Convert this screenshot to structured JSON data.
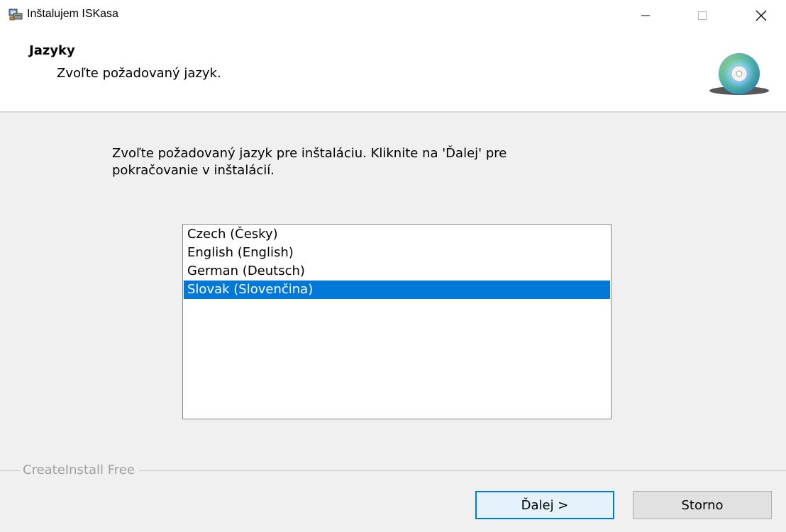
{
  "window": {
    "title": "Inštalujem ISKasa",
    "controls": {
      "minimize": "minimize-icon",
      "maximize": "maximize-icon",
      "close": "close-icon"
    }
  },
  "header": {
    "title": "Jazyky",
    "subtitle": "Zvoľte požadovaný jazyk.",
    "icon": "cd-disc-icon"
  },
  "main": {
    "instructions": "Zvoľte požadovaný jazyk pre inštaláciu. Kliknite na 'Ďalej' pre\npokračovanie v inštalácií.",
    "languages": [
      {
        "label": "Czech (Česky)",
        "selected": false
      },
      {
        "label": "English (English)",
        "selected": false
      },
      {
        "label": "German (Deutsch)",
        "selected": false
      },
      {
        "label": "Slovak (Slovenčina)",
        "selected": true
      }
    ]
  },
  "footer": {
    "brand": "CreateInstall Free",
    "next_label": "Ďalej >",
    "cancel_label": "Storno"
  },
  "colors": {
    "selection": "#0078d7",
    "window_bg": "#f0f0f0",
    "header_bg": "#ffffff"
  }
}
